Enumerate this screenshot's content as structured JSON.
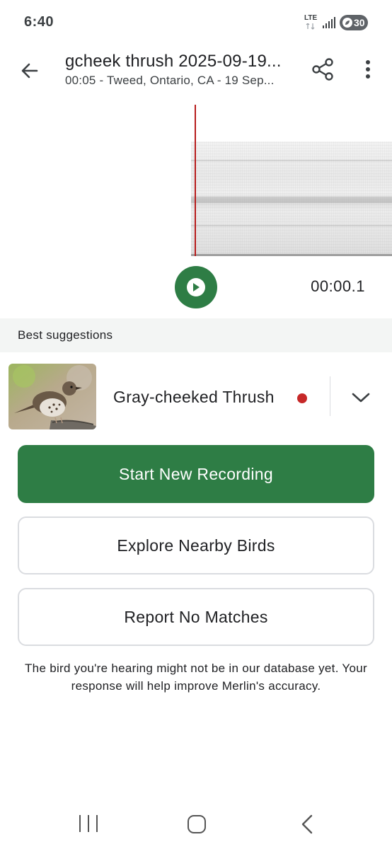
{
  "status_bar": {
    "time": "6:40",
    "network": "LTE",
    "battery": "30"
  },
  "app_bar": {
    "title": "gcheek thrush 2025-09-19...",
    "subtitle": "00:05 - Tweed, Ontario, CA - 19 Sep..."
  },
  "player": {
    "elapsed": "00:00.1"
  },
  "suggestions": {
    "header": "Best suggestions",
    "items": [
      {
        "name": "Gray-cheeked Thrush"
      }
    ]
  },
  "actions": {
    "start_recording": "Start New Recording",
    "explore_nearby": "Explore Nearby Birds",
    "report_no_matches": "Report No Matches"
  },
  "info_text": "The bird you're hearing might not be in our database yet. Your response will help improve Merlin's accuracy.",
  "colors": {
    "accent": "#2e7d45",
    "playhead": "#b71c1c",
    "seen_dot": "#c62828"
  }
}
